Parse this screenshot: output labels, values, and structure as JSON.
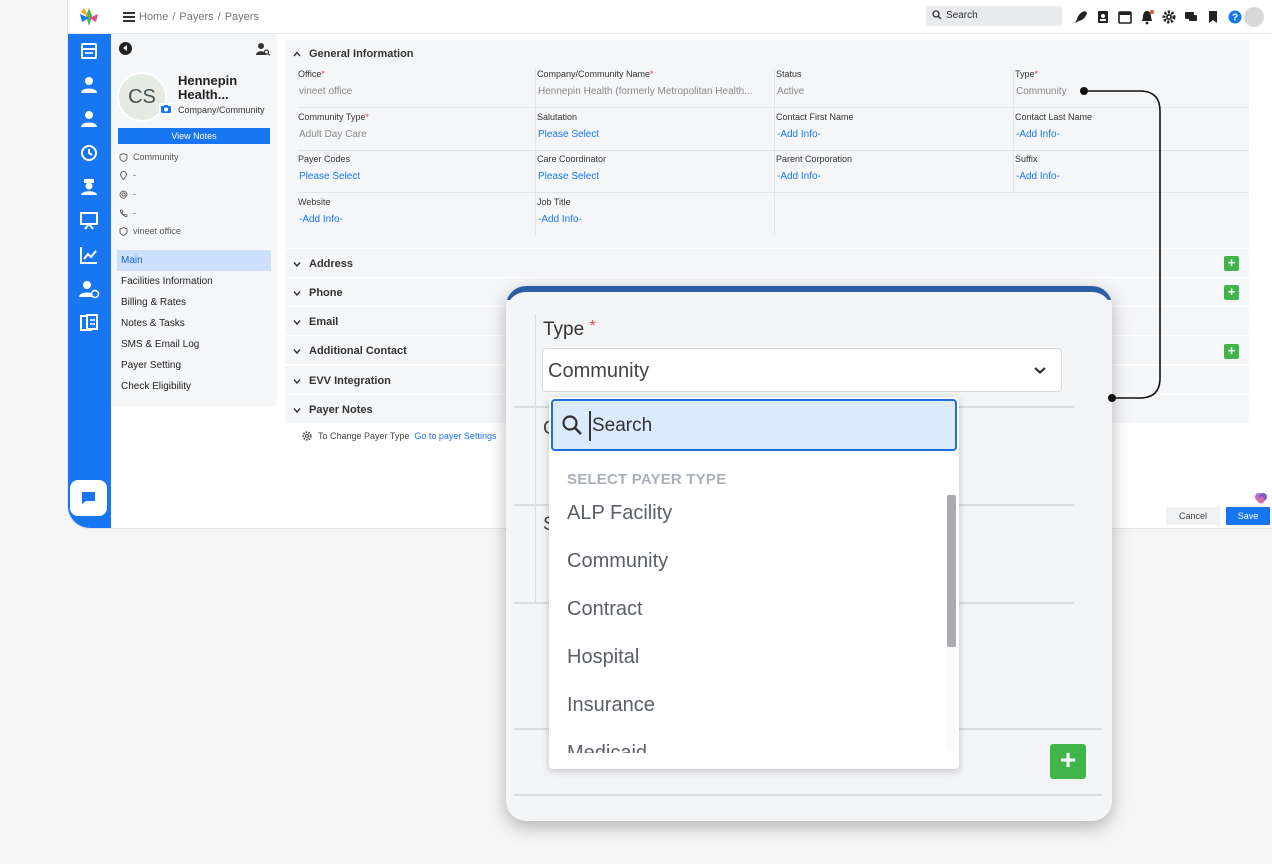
{
  "breadcrumb": [
    "Home",
    "Payers",
    "Payers"
  ],
  "global_search_placeholder": "Search",
  "profile": {
    "initials": "CS",
    "name": "Hennepin Health...",
    "type": "Company/Community",
    "view_notes_label": "View Notes",
    "info": [
      {
        "icon": "shield-icon",
        "text": "Community"
      },
      {
        "icon": "location-pin-icon",
        "text": "-"
      },
      {
        "icon": "at-sign-icon",
        "text": "-"
      },
      {
        "icon": "phone-icon",
        "text": "-"
      },
      {
        "icon": "shield-icon",
        "text": "vineet office"
      }
    ],
    "nav": [
      {
        "label": "Main",
        "active": true
      },
      {
        "label": "Facilities Information",
        "active": false
      },
      {
        "label": "Billing & Rates",
        "active": false
      },
      {
        "label": "Notes & Tasks",
        "active": false
      },
      {
        "label": "SMS & Email Log",
        "active": false
      },
      {
        "label": "Payer Setting",
        "active": false
      },
      {
        "label": "Check Eligibility",
        "active": false
      }
    ]
  },
  "general": {
    "title": "General Information",
    "fields": [
      {
        "label": "Office",
        "required": true,
        "value": "vineet office",
        "link": false
      },
      {
        "label": "Company/Community Name",
        "required": true,
        "value": "Hennepin Health (formerly Metropolitan Health...",
        "link": false
      },
      {
        "label": "Status",
        "required": false,
        "value": "Active",
        "link": false
      },
      {
        "label": "Type",
        "required": true,
        "value": "Community",
        "link": false
      },
      {
        "label": "Community Type",
        "required": true,
        "value": "Adult Day Care",
        "link": false
      },
      {
        "label": "Salutation",
        "required": false,
        "value": "Please Select",
        "link": true
      },
      {
        "label": "Contact First Name",
        "required": false,
        "value": "-Add Info-",
        "link": true
      },
      {
        "label": "Contact Last Name",
        "required": false,
        "value": "-Add Info-",
        "link": true
      },
      {
        "label": "Payer Codes",
        "required": false,
        "value": "Please Select",
        "link": true
      },
      {
        "label": "Care Coordinator",
        "required": false,
        "value": "Please Select",
        "link": true
      },
      {
        "label": "Parent Corporation",
        "required": false,
        "value": "-Add Info-",
        "link": true
      },
      {
        "label": "Suffix",
        "required": false,
        "value": "-Add Info-",
        "link": true
      },
      {
        "label": "Website",
        "required": false,
        "value": "-Add Info-",
        "link": true
      },
      {
        "label": "Job Title",
        "required": false,
        "value": "-Add Info-",
        "link": true
      }
    ]
  },
  "sections": [
    {
      "label": "Address",
      "has_add": true
    },
    {
      "label": "Phone",
      "has_add": true
    },
    {
      "label": "Email",
      "has_add": false
    },
    {
      "label": "Additional Contact",
      "has_add": true
    },
    {
      "label": "EVV Integration",
      "has_add": false
    },
    {
      "label": "Payer Notes",
      "has_add": false
    }
  ],
  "type_note": {
    "text": "To Change Payer Type",
    "link": "Go to payer Settings"
  },
  "footer": {
    "cancel": "Cancel",
    "save": "Save"
  },
  "zoom": {
    "type_label": "Type",
    "selected": "Community",
    "ghost_letters": [
      "C",
      "S"
    ],
    "add_symbol": "+"
  },
  "dropdown": {
    "search_placeholder": "Search",
    "header": "SELECT PAYER TYPE",
    "options": [
      "ALP Facility",
      "Community",
      "Contract",
      "Hospital",
      "Insurance",
      "Medicaid"
    ]
  },
  "add_symbol": "+",
  "required_mark": "*",
  "colors": {
    "primary": "#1976f2",
    "add_green": "#3fb54a",
    "required": "#e34a4a",
    "zoom_bar": "#2a5ea8"
  }
}
